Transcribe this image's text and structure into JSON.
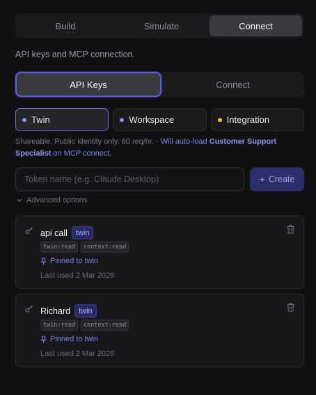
{
  "top_tabs": [
    {
      "label": "Build"
    },
    {
      "label": "Simulate"
    },
    {
      "label": "Connect"
    }
  ],
  "description": "API keys and MCP connection.",
  "sub_tabs": [
    {
      "label": "API Keys"
    },
    {
      "label": "Connect"
    }
  ],
  "scopes": [
    {
      "label": "Twin",
      "color": "#8b8ff0"
    },
    {
      "label": "Workspace",
      "color": "#9a86ec"
    },
    {
      "label": "Integration",
      "color": "#f2c230"
    }
  ],
  "info": {
    "text": "Shareable. Public identity only. 60 req/hr. · ",
    "link_prefix": "Will auto-load ",
    "link_strong": "Customer Support Specialist",
    "link_suffix": " on MCP connect."
  },
  "token": {
    "placeholder": "Token name (e.g. Claude Desktop)",
    "value": "",
    "create_label": "Create"
  },
  "advanced_label": "Advanced options",
  "keys": [
    {
      "name": "api call",
      "badge": "twin",
      "perms": [
        "twin:read",
        "context:read"
      ],
      "pinned": "Pinned to twin",
      "last_used": "Last used 2 Mar 2026"
    },
    {
      "name": "Richard",
      "badge": "twin",
      "perms": [
        "twin:read",
        "context:read"
      ],
      "pinned": "Pinned to twin",
      "last_used": "Last used 2 Mar 2026"
    }
  ]
}
